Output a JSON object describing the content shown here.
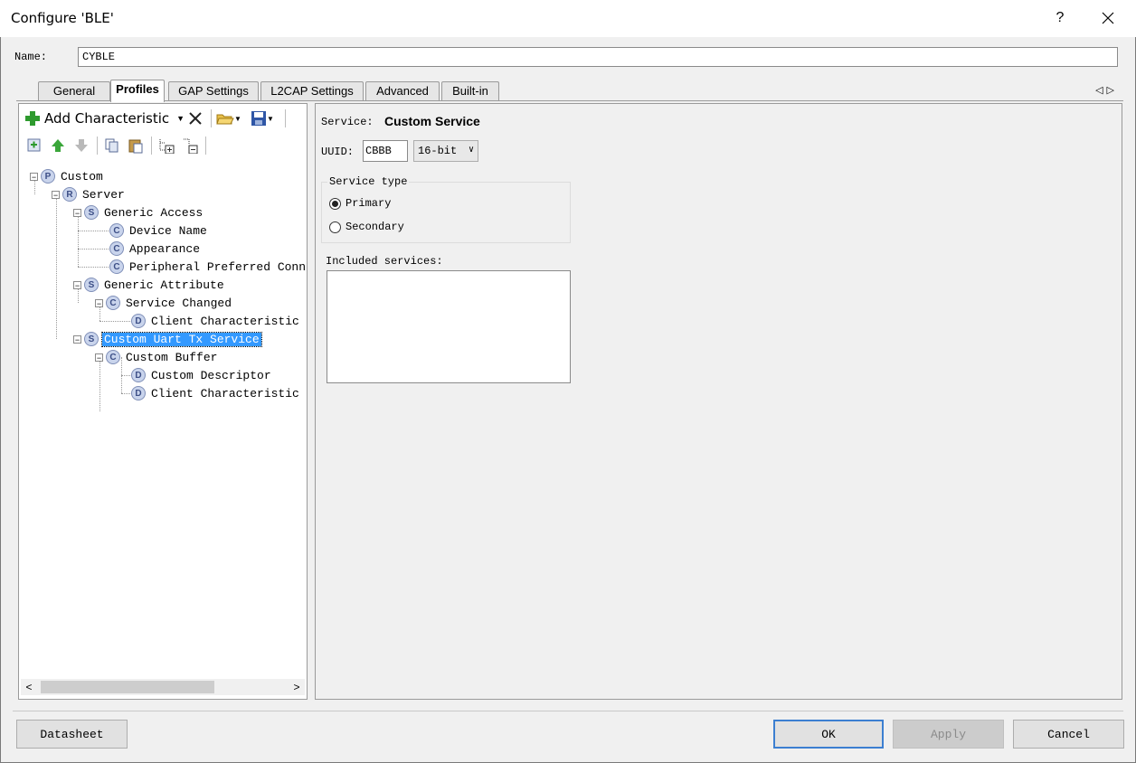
{
  "window": {
    "title": "Configure 'BLE'",
    "help": "?"
  },
  "name_field": {
    "label": "Name:",
    "value": "CYBLE"
  },
  "tabs": [
    {
      "label": "General"
    },
    {
      "label": "Profiles"
    },
    {
      "label": "GAP Settings"
    },
    {
      "label": "L2CAP Settings"
    },
    {
      "label": "Advanced"
    },
    {
      "label": "Built-in"
    }
  ],
  "active_tab": "Profiles",
  "toolbar": {
    "add_characteristic": "Add Characteristic"
  },
  "tree": [
    {
      "label": "Custom",
      "badge": "P"
    },
    {
      "label": "Server",
      "badge": "R"
    },
    {
      "label": "Generic Access",
      "badge": "S"
    },
    {
      "label": "Device Name",
      "badge": "C"
    },
    {
      "label": "Appearance",
      "badge": "C"
    },
    {
      "label": "Peripheral Preferred Conn",
      "badge": "C"
    },
    {
      "label": "Generic Attribute",
      "badge": "S"
    },
    {
      "label": "Service Changed",
      "badge": "C"
    },
    {
      "label": "Client Characteristic",
      "badge": "D"
    },
    {
      "label": "Custom Uart Tx Service",
      "badge": "S",
      "selected": true
    },
    {
      "label": "Custom Buffer",
      "badge": "C"
    },
    {
      "label": "Custom Descriptor",
      "badge": "D"
    },
    {
      "label": "Client Characteristic",
      "badge": "D"
    }
  ],
  "details": {
    "service_label": "Service:",
    "service_name": "Custom Service",
    "uuid_label": "UUID:",
    "uuid_value": "CBBB",
    "uuid_type": "16-bit",
    "service_type_legend": "Service type",
    "primary_label": "Primary",
    "secondary_label": "Secondary",
    "selected_type": "Primary",
    "included_services_label": "Included services:"
  },
  "buttons": {
    "datasheet": "Datasheet",
    "ok": "OK",
    "apply": "Apply",
    "cancel": "Cancel"
  },
  "colors": {
    "selection": "#3399ff",
    "badge_fill": "#c9d4ec",
    "ok_border": "#3c7fd1",
    "add_icon": "#2e9a2e"
  }
}
